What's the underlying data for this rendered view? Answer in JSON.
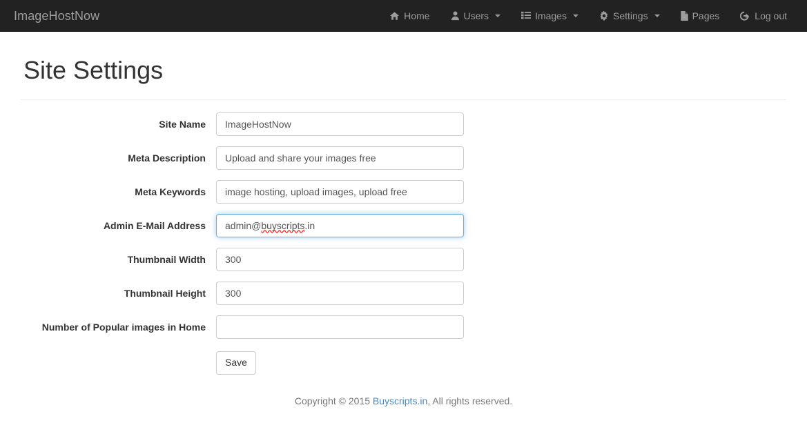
{
  "navbar": {
    "brand": "ImageHostNow",
    "items": [
      {
        "label": "Home",
        "icon": "home-icon",
        "caret": false
      },
      {
        "label": "Users",
        "icon": "user-icon",
        "caret": true
      },
      {
        "label": "Images",
        "icon": "list-icon",
        "caret": true
      },
      {
        "label": "Settings",
        "icon": "gear-icon",
        "caret": true
      },
      {
        "label": "Pages",
        "icon": "file-icon",
        "caret": false
      },
      {
        "label": "Log out",
        "icon": "sign-out-icon",
        "caret": false
      }
    ]
  },
  "page": {
    "title": "Site Settings"
  },
  "form": {
    "fields": [
      {
        "label": "Site Name",
        "value": "ImageHostNow",
        "placeholder": "",
        "focused": false
      },
      {
        "label": "Meta Description",
        "value": "Upload and share your images free",
        "placeholder": "",
        "focused": false
      },
      {
        "label": "Meta Keywords",
        "value": "image hosting, upload images, upload free",
        "placeholder": "",
        "focused": false
      },
      {
        "label": "Admin E-Mail Address",
        "value": "admin@buyscripts.in",
        "placeholder": "",
        "focused": true,
        "spellcheck_parts": {
          "before": "admin@",
          "misspelled": "buyscripts",
          "after": ".in"
        }
      },
      {
        "label": "Thumbnail Width",
        "value": "300",
        "placeholder": "",
        "focused": false
      },
      {
        "label": "Thumbnail Height",
        "value": "300",
        "placeholder": "",
        "focused": false
      },
      {
        "label": "Number of Popular images in Home",
        "value": "",
        "placeholder": "",
        "focused": false
      }
    ],
    "save_label": "Save"
  },
  "footer": {
    "copyright_prefix": "Copyright © 2015 ",
    "link_label": "Buyscripts.in",
    "copyright_suffix": ", All rights reserved."
  },
  "colors": {
    "navbar_bg": "#222222",
    "navbar_text": "#9d9d9d",
    "page_text": "#333333",
    "input_border": "#cccccc",
    "focus_border": "#66afe9",
    "link": "#428bca",
    "muted": "#777777",
    "spellcheck_underline": "#ef3b2d"
  }
}
